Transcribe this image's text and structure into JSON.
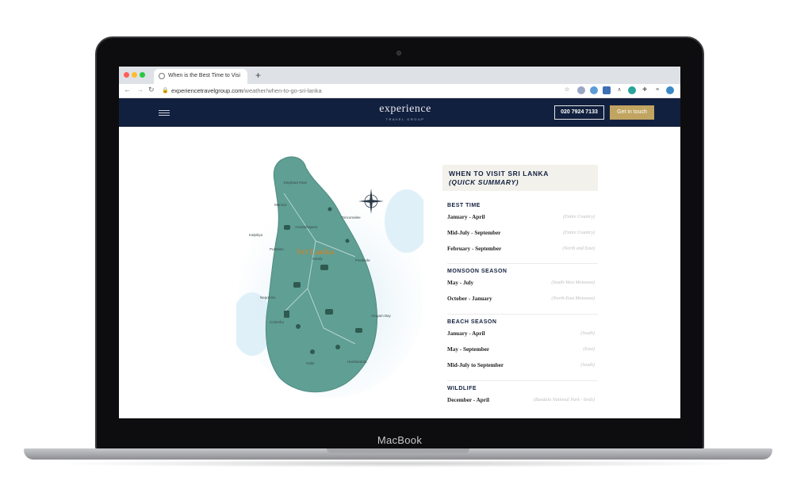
{
  "laptop": {
    "brand": "MacBook"
  },
  "browser": {
    "tab_title": "When is the Best Time to Visi",
    "url_domain": "experiencetravelgroup.com",
    "url_path": "/weather/when-to-go-sri-lanka",
    "new_tab_glyph": "+"
  },
  "header": {
    "logo": "experience",
    "logo_sub": "TRAVEL GROUP",
    "phone": "020 7924 7133",
    "cta": "Get in touch",
    "colors": {
      "nav_bg": "#12203f",
      "cta_bg": "#c1a460"
    }
  },
  "map": {
    "title": "Sri Lanka",
    "places": [
      "Elephant Pass",
      "Trincomalee",
      "Mannar",
      "Anuradhapura",
      "Kalpitiya",
      "Puttalam",
      "Pasikuda",
      "Kandy",
      "Negombo",
      "Colombo",
      "Arugam Bay",
      "Hambantota",
      "Galle"
    ]
  },
  "summary": {
    "title_line1": "WHEN TO VISIT SRI LANKA",
    "title_line2": "(QUICK SUMMARY)",
    "sections": [
      {
        "heading": "BEST TIME",
        "rows": [
          {
            "label": "January - April",
            "note": "(Entire Country)"
          },
          {
            "label": "Mid-July - September",
            "note": "(Entire Country)"
          },
          {
            "label": "February - September",
            "note": "(North and East)"
          }
        ]
      },
      {
        "heading": "MONSOON SEASON",
        "rows": [
          {
            "label": "May - July",
            "note": "(South-West Monsoon)"
          },
          {
            "label": "October - January",
            "note": "(North-East Monsoon)"
          }
        ]
      },
      {
        "heading": "BEACH SEASON",
        "rows": [
          {
            "label": "January - April",
            "note": "(South)"
          },
          {
            "label": "May - September",
            "note": "(East)"
          },
          {
            "label": "Mid-July to September",
            "note": "(South)"
          }
        ]
      },
      {
        "heading": "WILDLIFE",
        "rows": [
          {
            "label": "December - April",
            "note": "(Bundala National Park - birds)"
          }
        ]
      }
    ]
  }
}
